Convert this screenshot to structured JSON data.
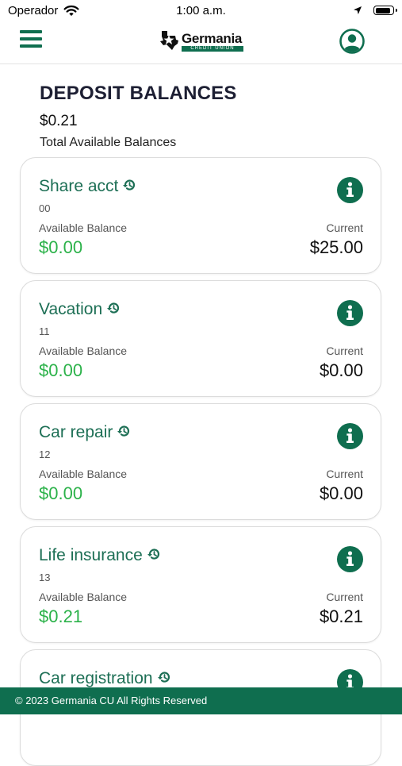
{
  "status": {
    "carrier": "Operador",
    "time": "1:00 a.m.",
    "battery_level": 0.9
  },
  "header": {
    "menu_icon": "hamburger-menu-icon",
    "logo": {
      "name": "Germania",
      "subtitle": "CREDIT UNION"
    },
    "profile_icon": "user-circle-icon"
  },
  "summary": {
    "title": "DEPOSIT BALANCES",
    "total": "$0.21",
    "label": "Total Available Balances"
  },
  "accounts": [
    {
      "name": "Share acct",
      "number": "00",
      "available_label": "Available Balance",
      "available": "$0.00",
      "current_label": "Current",
      "current": "$25.00"
    },
    {
      "name": "Vacation",
      "number": "11",
      "available_label": "Available Balance",
      "available": "$0.00",
      "current_label": "Current",
      "current": "$0.00"
    },
    {
      "name": "Car repair",
      "number": "12",
      "available_label": "Available Balance",
      "available": "$0.00",
      "current_label": "Current",
      "current": "$0.00"
    },
    {
      "name": "Life insurance",
      "number": "13",
      "available_label": "Available Balance",
      "available": "$0.21",
      "current_label": "Current",
      "current": "$0.21"
    },
    {
      "name": "Car registration",
      "number": "",
      "available_label": "",
      "available": "",
      "current_label": "",
      "current": ""
    }
  ],
  "footer": {
    "text": "© 2023 Germania CU All Rights Reserved"
  },
  "colors": {
    "brand_green": "#0f6e4f",
    "account_name": "#1d6f55",
    "available_green": "#2cb24a"
  }
}
